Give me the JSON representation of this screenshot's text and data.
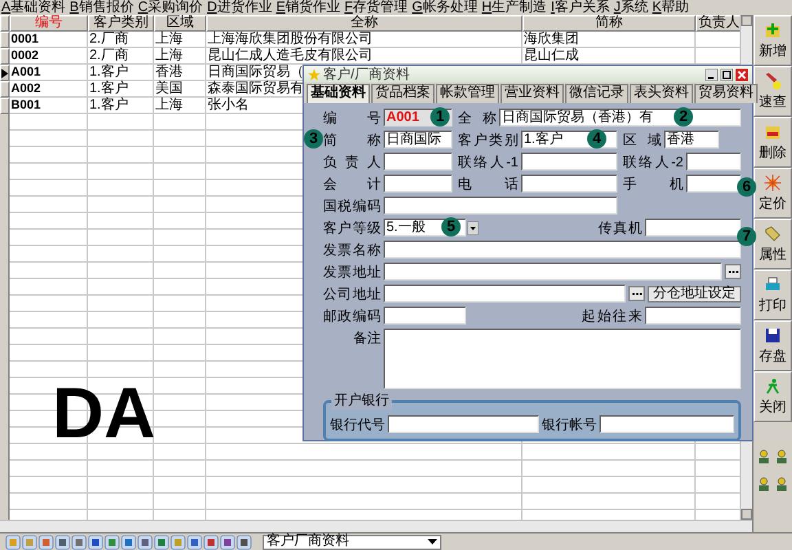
{
  "menu": [
    {
      "key": "A",
      "label": "基础资料"
    },
    {
      "key": "B",
      "label": "销售报价"
    },
    {
      "key": "C",
      "label": "采购询价"
    },
    {
      "key": "D",
      "label": "进货作业"
    },
    {
      "key": "E",
      "label": "销货作业"
    },
    {
      "key": "F",
      "label": "存货管理"
    },
    {
      "key": "G",
      "label": "帐务处理"
    },
    {
      "key": "H",
      "label": "生产制造"
    },
    {
      "key": "I",
      "label": "客户关系"
    },
    {
      "key": "J",
      "label": "系统"
    },
    {
      "key": "K",
      "label": "帮助"
    }
  ],
  "table": {
    "columns": [
      {
        "label": "编号",
        "sorted": true
      },
      {
        "label": "客户类别",
        "sorted": false
      },
      {
        "label": "区域",
        "sorted": false
      },
      {
        "label": "全称",
        "sorted": false
      },
      {
        "label": "简称",
        "sorted": false
      },
      {
        "label": "负责人",
        "sorted": false
      }
    ],
    "rows": [
      {
        "selected": false,
        "cells": [
          "0001",
          "2.厂商",
          "上海",
          "上海海欣集团股份有限公司",
          "海欣集团"
        ]
      },
      {
        "selected": false,
        "cells": [
          "0002",
          "2.厂商",
          "上海",
          "昆山仁成人造毛皮有限公司",
          "昆山仁成"
        ]
      },
      {
        "selected": true,
        "cells": [
          "A001",
          "1.客户",
          "香港",
          "日商国际贸易（"
        ]
      },
      {
        "selected": false,
        "cells": [
          "A002",
          "1.客户",
          "美国",
          "森泰国际贸易有"
        ]
      },
      {
        "selected": false,
        "cells": [
          "B001",
          "1.客户",
          "上海",
          "张小名"
        ]
      }
    ]
  },
  "toolbar": [
    {
      "kind": "add",
      "label": "新增"
    },
    {
      "kind": "search",
      "label": "速查"
    },
    {
      "kind": "delete",
      "label": "删除"
    },
    {
      "kind": "price",
      "label": "定价"
    },
    {
      "kind": "property",
      "label": "属性"
    },
    {
      "kind": "print",
      "label": "打印"
    },
    {
      "kind": "save",
      "label": "存盘"
    },
    {
      "kind": "close",
      "label": "关闭"
    }
  ],
  "dialog": {
    "title": "客户/厂商资料",
    "tabs": [
      {
        "label": "基础资料",
        "selected": true
      },
      {
        "label": "货品档案",
        "selected": false
      },
      {
        "label": "帐款管理",
        "selected": false
      },
      {
        "label": "营业资料",
        "selected": false
      },
      {
        "label": "微信记录",
        "selected": false
      },
      {
        "label": "表头资料",
        "selected": false
      },
      {
        "label": "贸易资料",
        "selected": false
      }
    ],
    "code": {
      "label": "编号",
      "value": "A001"
    },
    "full_name": {
      "label": "全称",
      "value": "日商国际贸易（香港）有"
    },
    "short_name": {
      "label": "简称",
      "value": "日商国际"
    },
    "category": {
      "label": "客户类别",
      "value": "1.客户"
    },
    "region": {
      "label": "区域",
      "value": "香港"
    },
    "manager": {
      "label": "负责人"
    },
    "contact_1": {
      "label": "联络人-1"
    },
    "contact_2": {
      "label": "联络人-2"
    },
    "accountant": {
      "label": "会计"
    },
    "phone": {
      "label": "电话"
    },
    "mobile": {
      "label": "手机"
    },
    "tax_code": {
      "label": "国税编码"
    },
    "level": {
      "label": "客户等级",
      "value": "5.一般"
    },
    "fax": {
      "label": "传真机"
    },
    "invoice_name": {
      "label": "发票名称"
    },
    "invoice_address": {
      "label": "发票地址"
    },
    "company_address": {
      "label": "公司地址"
    },
    "warehouse_button": "分仓地址设定",
    "postcode": {
      "label": "邮政编码"
    },
    "start_date": {
      "label": "起始往来"
    },
    "remark": {
      "label": "备注"
    },
    "bank": {
      "title": "开户银行",
      "code_label": "银行代号",
      "account_label": "银行帐号"
    }
  },
  "callouts": [
    "1",
    "2",
    "3",
    "4",
    "5",
    "6",
    "7"
  ],
  "overlay_text": "DA",
  "status_bar": {
    "dropdown": "客户厂商资料"
  }
}
